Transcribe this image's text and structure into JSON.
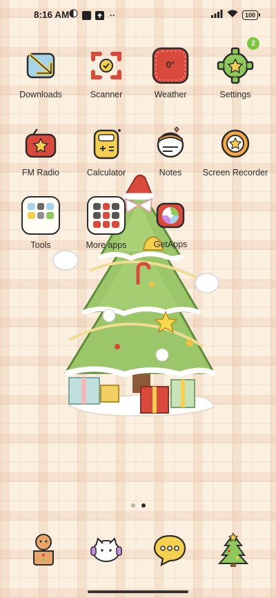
{
  "status_bar": {
    "time": "8:16 AM",
    "battery": "100"
  },
  "apps": [
    {
      "label": "Downloads",
      "icon": "downloads-icon"
    },
    {
      "label": "Scanner",
      "icon": "scanner-icon"
    },
    {
      "label": "Weather",
      "icon": "weather-icon",
      "value": "0°"
    },
    {
      "label": "Settings",
      "icon": "settings-gear-icon",
      "badge": "2"
    },
    {
      "label": "FM Radio",
      "icon": "fm-radio-icon"
    },
    {
      "label": "Calculator",
      "icon": "calculator-icon"
    },
    {
      "label": "Notes",
      "icon": "notes-icon"
    },
    {
      "label": "Screen Recorder",
      "icon": "screen-recorder-icon"
    },
    {
      "label": "Tools",
      "icon": "tools-folder-icon"
    },
    {
      "label": "More apps",
      "icon": "more-apps-folder-icon"
    },
    {
      "label": "GetApps",
      "icon": "getapps-icon"
    }
  ],
  "wallpaper": {
    "subject": "christmas-tree-wallpaper"
  },
  "page_indicator": {
    "pages": 2,
    "active": 2
  },
  "dock": [
    {
      "icon": "gingerbread-phone-icon"
    },
    {
      "icon": "contacts-cat-icon"
    },
    {
      "icon": "messages-bubble-icon"
    },
    {
      "icon": "christmas-tree-browser-icon"
    }
  ],
  "colors": {
    "background": "#fbf0df",
    "plaid": "#deb296",
    "badge": "#7cc63d",
    "icon_red": "#d94a3d",
    "icon_yellow": "#f5cf4e"
  }
}
